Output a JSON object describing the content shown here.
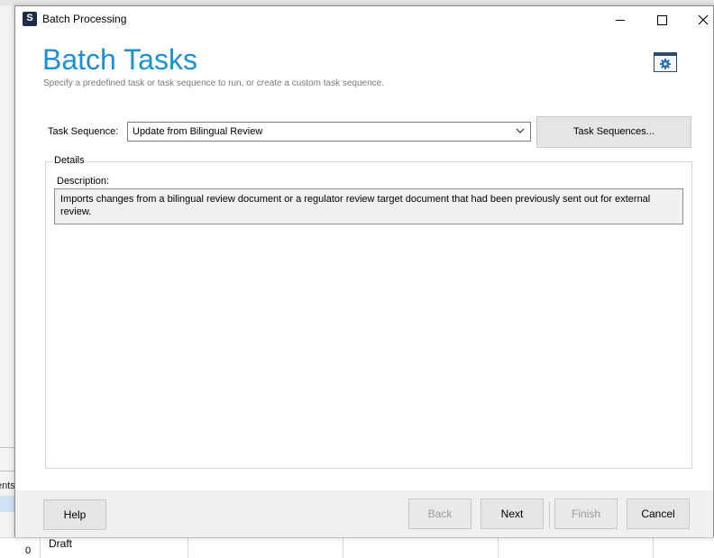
{
  "background": {
    "partial_label": "ents",
    "row_number": "0",
    "row_status": "Draft"
  },
  "window": {
    "title": "Batch Processing",
    "app_icon_letter": "S",
    "controls": {
      "minimize": "minimize-icon",
      "maximize": "maximize-icon",
      "close": "×"
    }
  },
  "header": {
    "title": "Batch Tasks",
    "subtitle": "Specify a predefined task or task sequence to run, or create a custom task sequence.",
    "settings_icon": "settings-gear-icon"
  },
  "task_sequence": {
    "label": "Task Sequence:",
    "selected": "Update from Bilingual Review",
    "button_label": "Task Sequences..."
  },
  "details": {
    "legend": "Details",
    "description_label": "Description:",
    "description_text": "Imports changes from a bilingual review document or a regulator review target document that had been previously sent out for external review."
  },
  "footer": {
    "help": "Help",
    "back": "Back",
    "next": "Next",
    "finish": "Finish",
    "cancel": "Cancel"
  },
  "colors": {
    "accent": "#1a91d6",
    "button_bg": "#e5e5e5",
    "footer_bg": "#f0f0f0"
  }
}
